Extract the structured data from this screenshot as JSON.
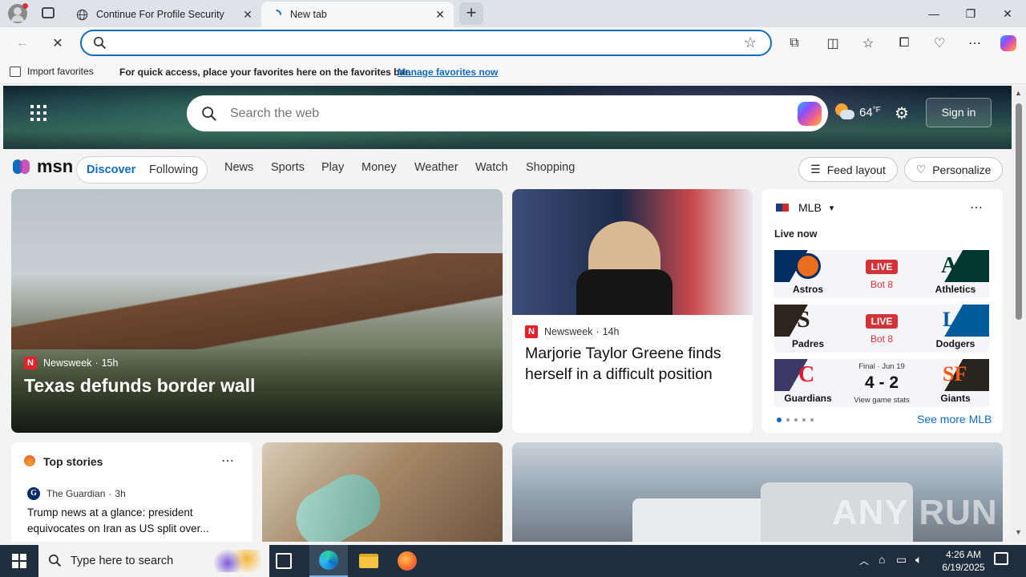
{
  "tabs": [
    {
      "title": "Continue For Profile Security",
      "icon": "globe-icon"
    },
    {
      "title": "New tab",
      "icon": "loading-spinner-icon"
    }
  ],
  "address": {
    "value": "",
    "placeholder": ""
  },
  "favbar": {
    "import_label": "Import favorites",
    "message": "For quick access, place your favorites here on the favorites bar.",
    "manage_link": "Manage favorites now"
  },
  "msn": {
    "search_placeholder": "Search the web",
    "weather_temp": "64",
    "weather_unit": "°F",
    "sign_in": "Sign in",
    "logo_text": "msn",
    "nav": {
      "discover": "Discover",
      "following": "Following",
      "links": [
        "News",
        "Sports",
        "Play",
        "Money",
        "Weather",
        "Watch",
        "Shopping"
      ]
    },
    "feed_layout": "Feed layout",
    "personalize": "Personalize"
  },
  "hero": {
    "source": "Newsweek",
    "age": "15h",
    "headline": "Texas defunds border wall"
  },
  "story2": {
    "source": "Newsweek",
    "age": "14h",
    "headline": "Marjorie Taylor Greene finds herself in a difficult position"
  },
  "mlb": {
    "title": "MLB",
    "live_now": "Live now",
    "see_more": "See more MLB",
    "games": [
      {
        "home": "Astros",
        "away": "Athletics",
        "status": "LIVE",
        "detail": "Bot 8"
      },
      {
        "home": "Padres",
        "away": "Dodgers",
        "status": "LIVE",
        "detail": "Bot 8"
      },
      {
        "home": "Guardians",
        "away": "Giants",
        "status": "Final · Jun 19",
        "score": "4 - 2",
        "detail": "View game stats"
      }
    ]
  },
  "top_stories": {
    "title": "Top stories",
    "source": "The Guardian",
    "age": "3h",
    "headline": "Trump news at a glance: president equivocates on Iran as US split over..."
  },
  "watermark": "ANY RUN",
  "taskbar": {
    "search_placeholder": "Type here to search",
    "time": "4:26 AM",
    "date": "6/19/2025"
  },
  "colors": {
    "accent": "#0f6cbd",
    "live": "#d13438",
    "msn_blue": "#0f6cbd"
  }
}
